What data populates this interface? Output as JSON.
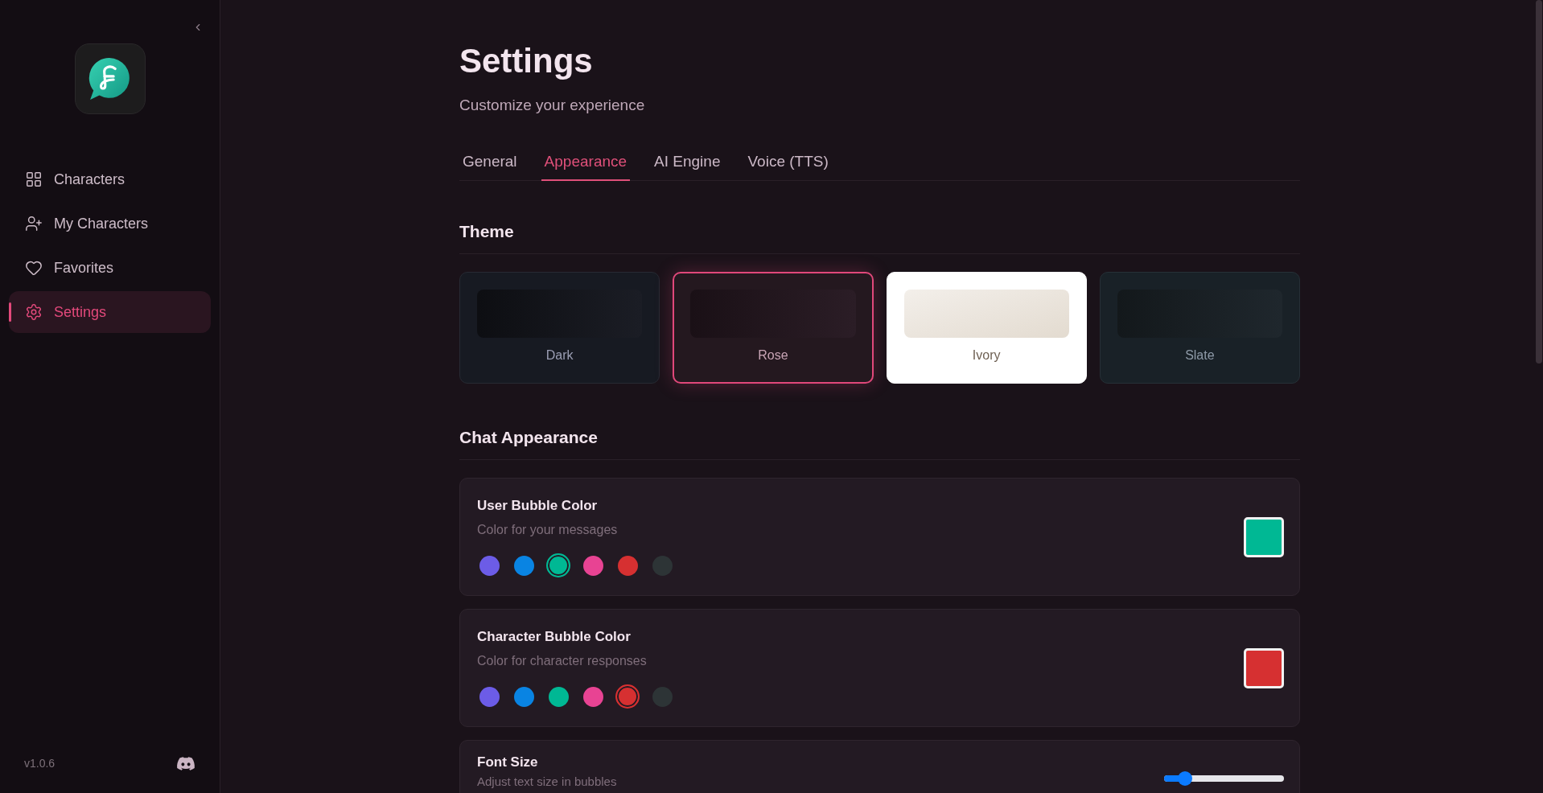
{
  "sidebar": {
    "nav": [
      {
        "label": "Characters",
        "selected": false
      },
      {
        "label": "My Characters",
        "selected": false
      },
      {
        "label": "Favorites",
        "selected": false
      },
      {
        "label": "Settings",
        "selected": true
      }
    ],
    "version": "v1.0.6"
  },
  "header": {
    "title": "Settings",
    "subtitle": "Customize your experience"
  },
  "tabs": [
    {
      "label": "General",
      "selected": false
    },
    {
      "label": "Appearance",
      "selected": true
    },
    {
      "label": "AI Engine",
      "selected": false
    },
    {
      "label": "Voice (TTS)",
      "selected": false
    }
  ],
  "theme": {
    "heading": "Theme",
    "options": [
      {
        "label": "Dark",
        "kind": "dark",
        "selected": false
      },
      {
        "label": "Rose",
        "kind": "rose",
        "selected": true
      },
      {
        "label": "Ivory",
        "kind": "ivory",
        "selected": false
      },
      {
        "label": "Slate",
        "kind": "slate",
        "selected": false
      }
    ]
  },
  "chat_appearance": {
    "heading": "Chat Appearance",
    "settings": [
      {
        "kind": "color",
        "title": "User Bubble Color",
        "description": "Color for your messages",
        "swatches": [
          {
            "color": "#6c5ce7",
            "selected": false
          },
          {
            "color": "#0984e3",
            "selected": false
          },
          {
            "color": "#00b894",
            "selected": true
          },
          {
            "color": "#e84393",
            "selected": false
          },
          {
            "color": "#d63031",
            "selected": false
          },
          {
            "color": "#2d3436",
            "selected": false
          }
        ]
      },
      {
        "kind": "color",
        "title": "Character Bubble Color",
        "description": "Color for character responses",
        "swatches": [
          {
            "color": "#6c5ce7",
            "selected": false
          },
          {
            "color": "#0984e3",
            "selected": false
          },
          {
            "color": "#00b894",
            "selected": false
          },
          {
            "color": "#e84393",
            "selected": false
          },
          {
            "color": "#d63031",
            "selected": true
          },
          {
            "color": "#2d3436",
            "selected": false
          }
        ]
      },
      {
        "kind": "slider",
        "title": "Font Size",
        "description": "Adjust text size in bubbles",
        "level": 0.13
      }
    ]
  }
}
